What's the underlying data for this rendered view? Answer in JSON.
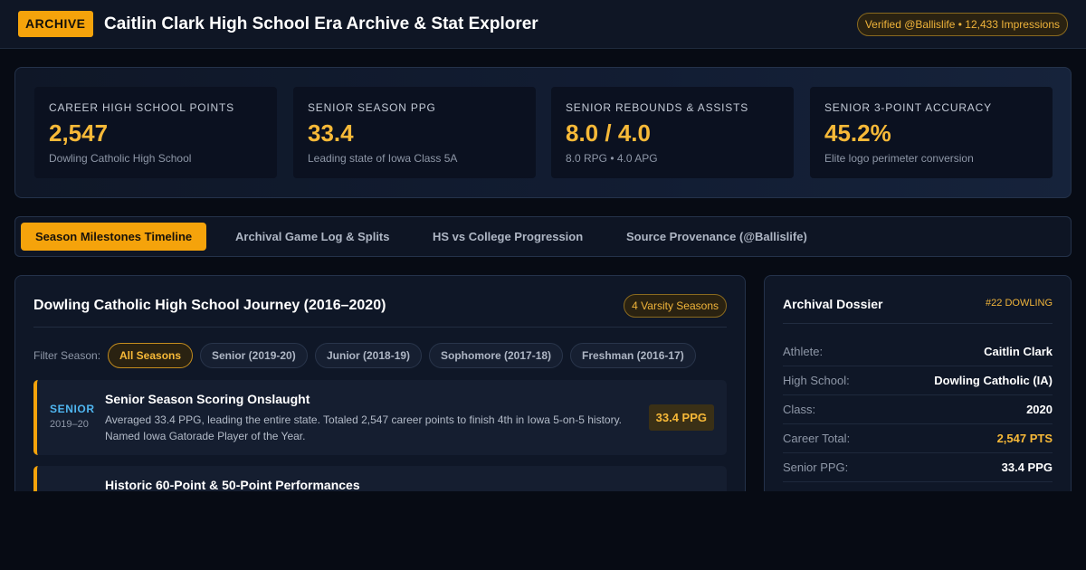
{
  "header": {
    "badge": "ARCHIVE",
    "title": "Caitlin Clark High School Era Archive & Stat Explorer",
    "verification": "Verified @Ballislife • 12,433 Impressions"
  },
  "stats": [
    {
      "label": "CAREER HIGH SCHOOL POINTS",
      "value": "2,547",
      "sub": "Dowling Catholic High School"
    },
    {
      "label": "SENIOR SEASON PPG",
      "value": "33.4",
      "sub": "Leading state of Iowa Class 5A"
    },
    {
      "label": "SENIOR REBOUNDS & ASSISTS",
      "value": "8.0 / 4.0",
      "sub": "8.0 RPG • 4.0 APG"
    },
    {
      "label": "SENIOR 3-POINT ACCURACY",
      "value": "45.2%",
      "sub": "Elite logo perimeter conversion"
    }
  ],
  "tabs": [
    {
      "label": "Season Milestones Timeline",
      "active": true
    },
    {
      "label": "Archival Game Log & Splits",
      "active": false
    },
    {
      "label": "HS vs College Progression",
      "active": false
    },
    {
      "label": "Source Provenance (@Ballislife)",
      "active": false
    }
  ],
  "journey": {
    "title": "Dowling Catholic High School Journey (2016–2020)",
    "badge": "4 Varsity Seasons",
    "filter_label": "Filter Season:",
    "filters": [
      {
        "label": "All Seasons",
        "active": true
      },
      {
        "label": "Senior (2019-20)",
        "active": false
      },
      {
        "label": "Junior (2018-19)",
        "active": false
      },
      {
        "label": "Sophomore (2017-18)",
        "active": false
      },
      {
        "label": "Freshman (2016-17)",
        "active": false
      }
    ],
    "milestones": [
      {
        "season": "SENIOR",
        "years": "2019–20",
        "title": "Senior Season Scoring Onslaught",
        "description": "Averaged 33.4 PPG, leading the entire state. Totaled 2,547 career points to finish 4th in Iowa 5-on-5 history. Named Iowa Gatorade Player of the Year.",
        "stat": "33.4 PPG"
      },
      {
        "season": "",
        "years": "",
        "title": "Historic 60-Point & 50-Point Performances",
        "description": "",
        "stat": ""
      }
    ]
  },
  "dossier": {
    "title": "Archival Dossier",
    "tag": "#22 DOWLING",
    "rows": [
      {
        "key": "Athlete:",
        "value": "Caitlin Clark"
      },
      {
        "key": "High School:",
        "value": "Dowling Catholic (IA)"
      },
      {
        "key": "Class:",
        "value": "2020"
      },
      {
        "key": "Career Total:",
        "value": "2,547 PTS"
      },
      {
        "key": "Senior PPG:",
        "value": "33.4 PPG"
      }
    ]
  },
  "colors": {
    "accent": "#f5a30b",
    "season_label": "#4fb6f0",
    "background": "#070b14"
  }
}
